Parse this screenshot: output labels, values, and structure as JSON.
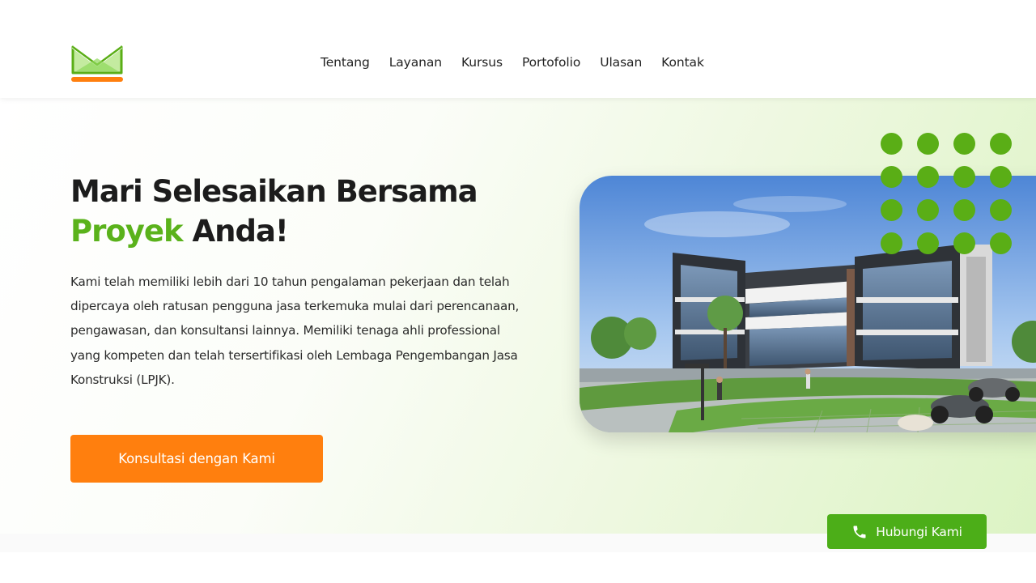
{
  "nav": {
    "logo_name": "m-chevron-logo",
    "items": [
      {
        "label": "Tentang"
      },
      {
        "label": "Layanan"
      },
      {
        "label": "Kursus"
      },
      {
        "label": "Portofolio"
      },
      {
        "label": "Ulasan"
      },
      {
        "label": "Kontak"
      }
    ]
  },
  "hero": {
    "headline_line1": "Mari Selesaikan Bersama",
    "headline_accent": "Proyek",
    "headline_rest": "Anda!",
    "description": "Kami telah memiliki lebih dari 10 tahun pengalaman pekerjaan dan telah dipercaya oleh ratusan pengguna jasa terkemuka mulai dari perencanaan, pengawasan, dan konsultansi lainnya. Memiliki tenaga ahli professional yang kompeten dan telah tersertifikasi oleh Lembaga Pengembangan Jasa Konstruksi (LPJK).",
    "cta_label": "Konsultasi dengan Kami",
    "image_subject": "modern-office-building-rendering"
  },
  "floating": {
    "contact_label": "Hubungi Kami",
    "contact_icon": "phone-icon"
  },
  "colors": {
    "accent_green": "#5ab21b",
    "cta_orange": "#ff7f0e",
    "contact_green": "#4cae18"
  }
}
